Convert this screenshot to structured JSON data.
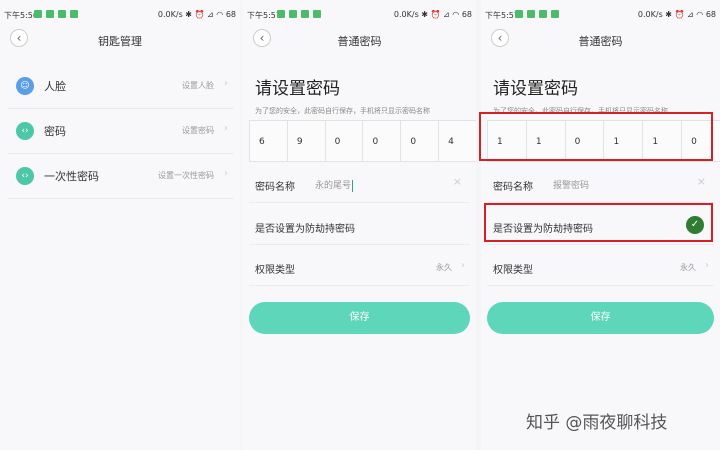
{
  "colors": {
    "accent": "#5ed6b9",
    "highlight": "#d62027",
    "check": "#2e7d32"
  },
  "statusbar": {
    "p1": {
      "time": "下午5:56",
      "right": "0.0K/s ✱ ⏰ ⊿ ◠ 68"
    },
    "p2": {
      "time": "下午5:57",
      "right": "0.0K/s ✱ ⏰ ⊿ ◠ 68"
    },
    "p3": {
      "time": "下午5:57",
      "right": "0.0K/s ✱ ⏰ ⊿ ◠ 68"
    }
  },
  "screen1": {
    "back_icon": "‹",
    "title": "钥匙管理",
    "items": [
      {
        "label": "人脸",
        "value": "设置人脸",
        "icon": "face-icon",
        "icon_glyph": "☺",
        "color": "#5a9ee8"
      },
      {
        "label": "密码",
        "value": "设置密码",
        "icon": "password-icon",
        "icon_glyph": "‹›",
        "color": "#4cc7a8"
      },
      {
        "label": "一次性密码",
        "value": "设置一次性密码",
        "icon": "onetime-password-icon",
        "icon_glyph": "‹›",
        "color": "#4cc7a8"
      }
    ],
    "chevron": "›"
  },
  "screen2": {
    "back_icon": "‹",
    "title": "普通密码",
    "heading": "请设置密码",
    "subtext": "为了您的安全，此密码自行保存，手机将只显示密码名称",
    "digits": [
      "6",
      "9",
      "0",
      "0",
      "0",
      "4"
    ],
    "name_label": "密码名称",
    "name_value": "永的尾号",
    "clear_icon": "×",
    "duress_label": "是否设置为防劫持密码",
    "perm_label": "权限类型",
    "perm_value": "永久",
    "chevron": "›",
    "save": "保存"
  },
  "screen3": {
    "back_icon": "‹",
    "title": "普通密码",
    "heading": "请设置密码",
    "subtext": "为了您的安全，此密码自行保存，手机将只显示密码名称",
    "digits": [
      "1",
      "1",
      "0",
      "1",
      "1",
      "0"
    ],
    "name_label": "密码名称",
    "name_value": "报警密码",
    "clear_icon": "×",
    "duress_label": "是否设置为防劫持密码",
    "check_icon": "✓",
    "perm_label": "权限类型",
    "perm_value": "永久",
    "chevron": "›",
    "save": "保存"
  },
  "watermark": "知乎 @雨夜聊科技"
}
